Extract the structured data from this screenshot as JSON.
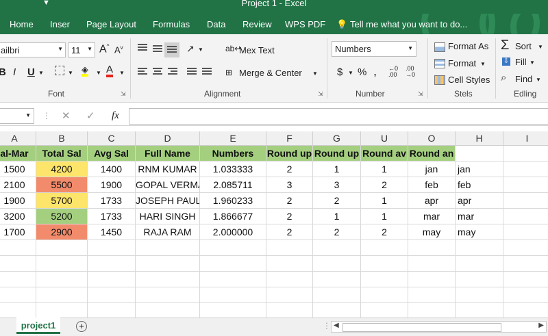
{
  "window": {
    "title": "Project 1 - Excel"
  },
  "menu": {
    "tabs": [
      "Home",
      "Inser",
      "Page Layout",
      "Formulas",
      "Data",
      "Review",
      "WPS PDF"
    ],
    "tell_me": "Tell me what you want to do..."
  },
  "ribbon": {
    "font_name": "ailbri",
    "font_size": "11",
    "grow_font": "A",
    "shrink_font": "A",
    "bold": "B",
    "italic": "I",
    "underline": "U",
    "font_color_glyph": "A",
    "font_group": "Font",
    "wrap_text": "Mex Text",
    "merge_center": "Merge & Center",
    "alignment_group": "Alignment",
    "number_format": "Numbers",
    "currency": "$",
    "percent": "%",
    "comma": ",",
    "number_group": "Number",
    "format_as": "Format As",
    "format": "Format",
    "cell_styles": "Cell Styles",
    "styles_group": "Stels",
    "sort": "Sort",
    "fill": "Fill",
    "find": "Find",
    "editing_group": "Edling"
  },
  "formula_bar": {
    "cancel": "✕",
    "enter": "✓",
    "fx": "fx",
    "value": ""
  },
  "sheet": {
    "columns": [
      "A",
      "B",
      "C",
      "D",
      "E",
      "F",
      "G",
      "U",
      "O",
      "H",
      "I"
    ],
    "header_row": [
      "al-Mar",
      "Total Sal",
      "Avg Sal",
      "Full Name",
      "Numbers",
      "Round up",
      "Round up",
      "Round av",
      "Round an",
      "",
      ""
    ],
    "rows": [
      [
        "1500",
        "4200",
        "1400",
        "RNM KUMAR",
        "1.033333",
        "2",
        "1",
        "1",
        "jan",
        "jan",
        ""
      ],
      [
        "2100",
        "5500",
        "1900",
        "GOPAL VERMA",
        "2.085711",
        "3",
        "3",
        "2",
        "feb",
        "feb",
        ""
      ],
      [
        "1900",
        "5700",
        "1733",
        "JOSEPH PAUL",
        "1.960233",
        "2",
        "2",
        "1",
        "apr",
        "apr",
        ""
      ],
      [
        "3200",
        "5200",
        "1733",
        "HARI SINGH",
        "1.866677",
        "2",
        "1",
        "1",
        "mar",
        "mar",
        ""
      ],
      [
        "1700",
        "2900",
        "1450",
        "RAJA RAM",
        "2.000000",
        "2",
        "2",
        "2",
        "may",
        "may",
        ""
      ]
    ],
    "total_sal_colors": [
      "#fde46b",
      "#f28b6b",
      "#fde46b",
      "#a4cf7f",
      "#f28b6b"
    ]
  },
  "sheet_tabs": {
    "active": "project1",
    "add": "+"
  },
  "colors": {
    "excel_green": "#217346",
    "header_green": "#a4cf7f"
  }
}
